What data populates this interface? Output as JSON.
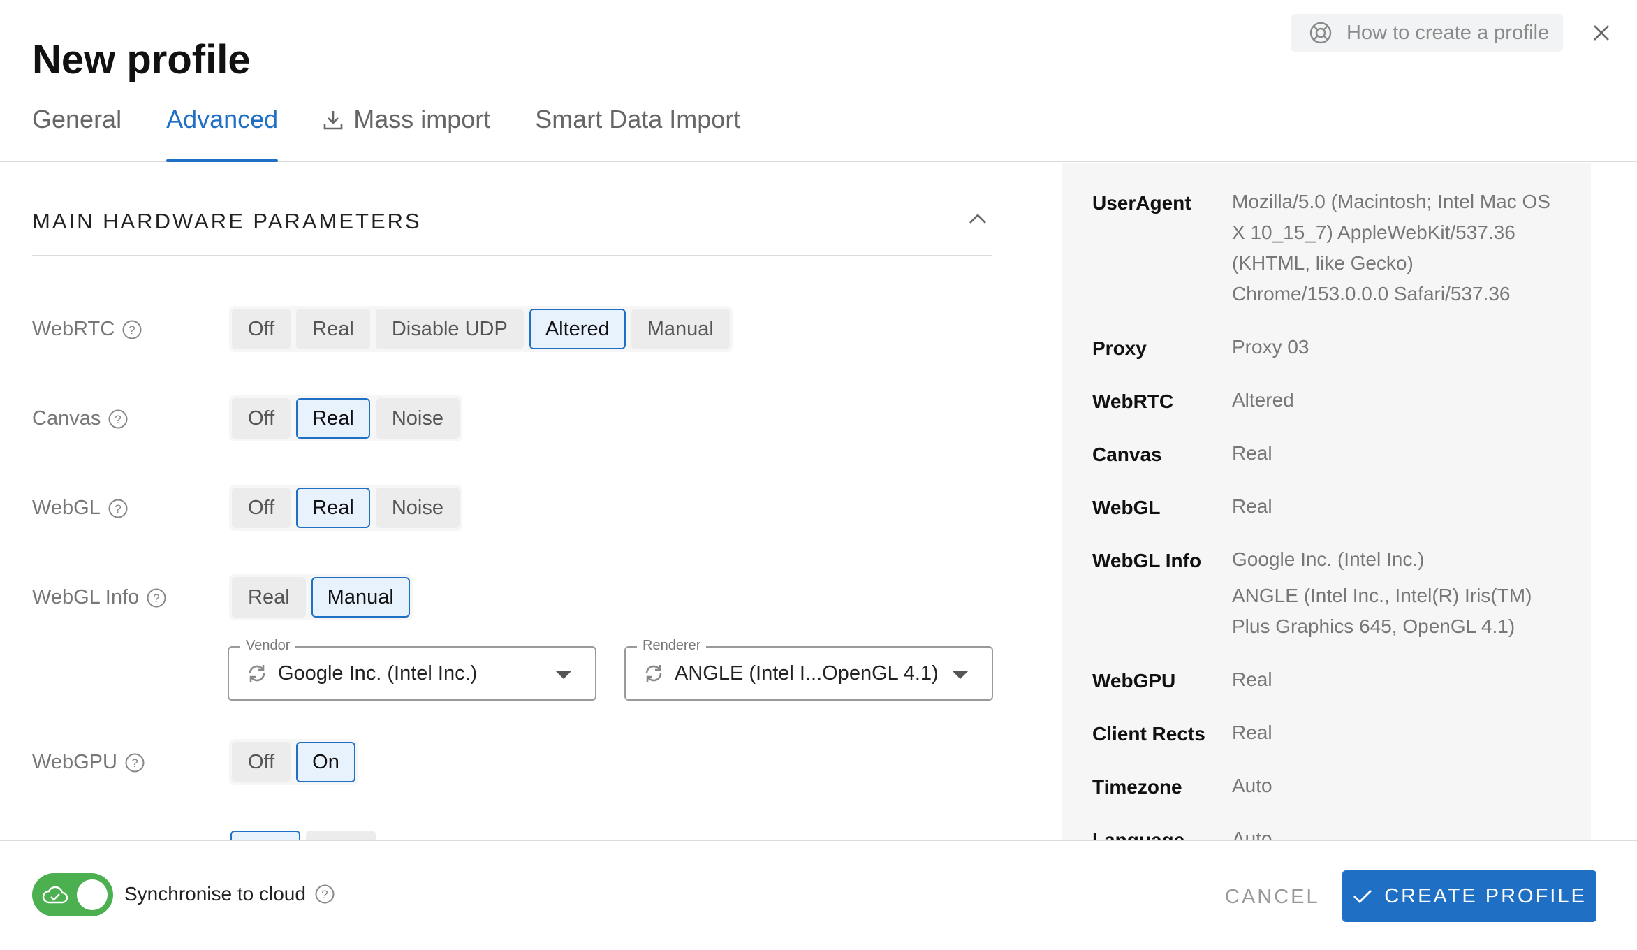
{
  "header": {
    "title": "New profile",
    "help_link": "How to create a profile"
  },
  "tabs": [
    {
      "label": "General",
      "active": false
    },
    {
      "label": "Advanced",
      "active": true
    },
    {
      "label": "Mass import",
      "active": false
    },
    {
      "label": "Smart Data Import",
      "active": false
    }
  ],
  "section": {
    "title": "MAIN HARDWARE PARAMETERS"
  },
  "params": {
    "webrtc": {
      "label": "WebRTC",
      "options": [
        "Off",
        "Real",
        "Disable UDP",
        "Altered",
        "Manual"
      ],
      "selected": "Altered"
    },
    "canvas": {
      "label": "Canvas",
      "options": [
        "Off",
        "Real",
        "Noise"
      ],
      "selected": "Real"
    },
    "webgl": {
      "label": "WebGL",
      "options": [
        "Off",
        "Real",
        "Noise"
      ],
      "selected": "Real"
    },
    "webgl_info": {
      "label": "WebGL Info",
      "options": [
        "Real",
        "Manual"
      ],
      "selected": "Manual"
    },
    "webgpu": {
      "label": "WebGPU",
      "options": [
        "Off",
        "On"
      ],
      "selected": "On"
    }
  },
  "vendor": {
    "legend": "Vendor",
    "value": "Google Inc. (Intel Inc.)"
  },
  "renderer": {
    "legend": "Renderer",
    "value": "ANGLE (Intel I...OpenGL 4.1)"
  },
  "summary": {
    "useragent": {
      "key": "UserAgent",
      "value": "Mozilla/5.0 (Macintosh; Intel Mac OS X 10_15_7) AppleWebKit/537.36 (KHTML, like Gecko) Chrome/153.0.0.0 Safari/537.36"
    },
    "proxy": {
      "key": "Proxy",
      "value": "Proxy 03"
    },
    "webrtc": {
      "key": "WebRTC",
      "value": "Altered"
    },
    "canvas": {
      "key": "Canvas",
      "value": "Real"
    },
    "webgl": {
      "key": "WebGL",
      "value": "Real"
    },
    "webgl_info": {
      "key": "WebGL Info",
      "value1": "Google Inc. (Intel Inc.)",
      "value2": "ANGLE (Intel Inc., Intel(R) Iris(TM) Plus Graphics 645, OpenGL 4.1)"
    },
    "webgpu": {
      "key": "WebGPU",
      "value": "Real"
    },
    "client_rects": {
      "key": "Client Rects",
      "value": "Real"
    },
    "timezone": {
      "key": "Timezone",
      "value": "Auto"
    },
    "language": {
      "key": "Language",
      "value": "Auto"
    }
  },
  "footer": {
    "sync_label": "Synchronise to cloud",
    "sync_on": true,
    "cancel": "CANCEL",
    "create": "CREATE PROFILE"
  },
  "colors": {
    "accent": "#1f6fc5",
    "toggle_on": "#4caf50"
  },
  "icons": [
    "lifebuoy-icon",
    "close-icon",
    "download-icon",
    "chevron-up-icon",
    "help-circle-icon",
    "refresh-icon",
    "caret-down-icon",
    "cloud-check-icon",
    "check-icon"
  ]
}
